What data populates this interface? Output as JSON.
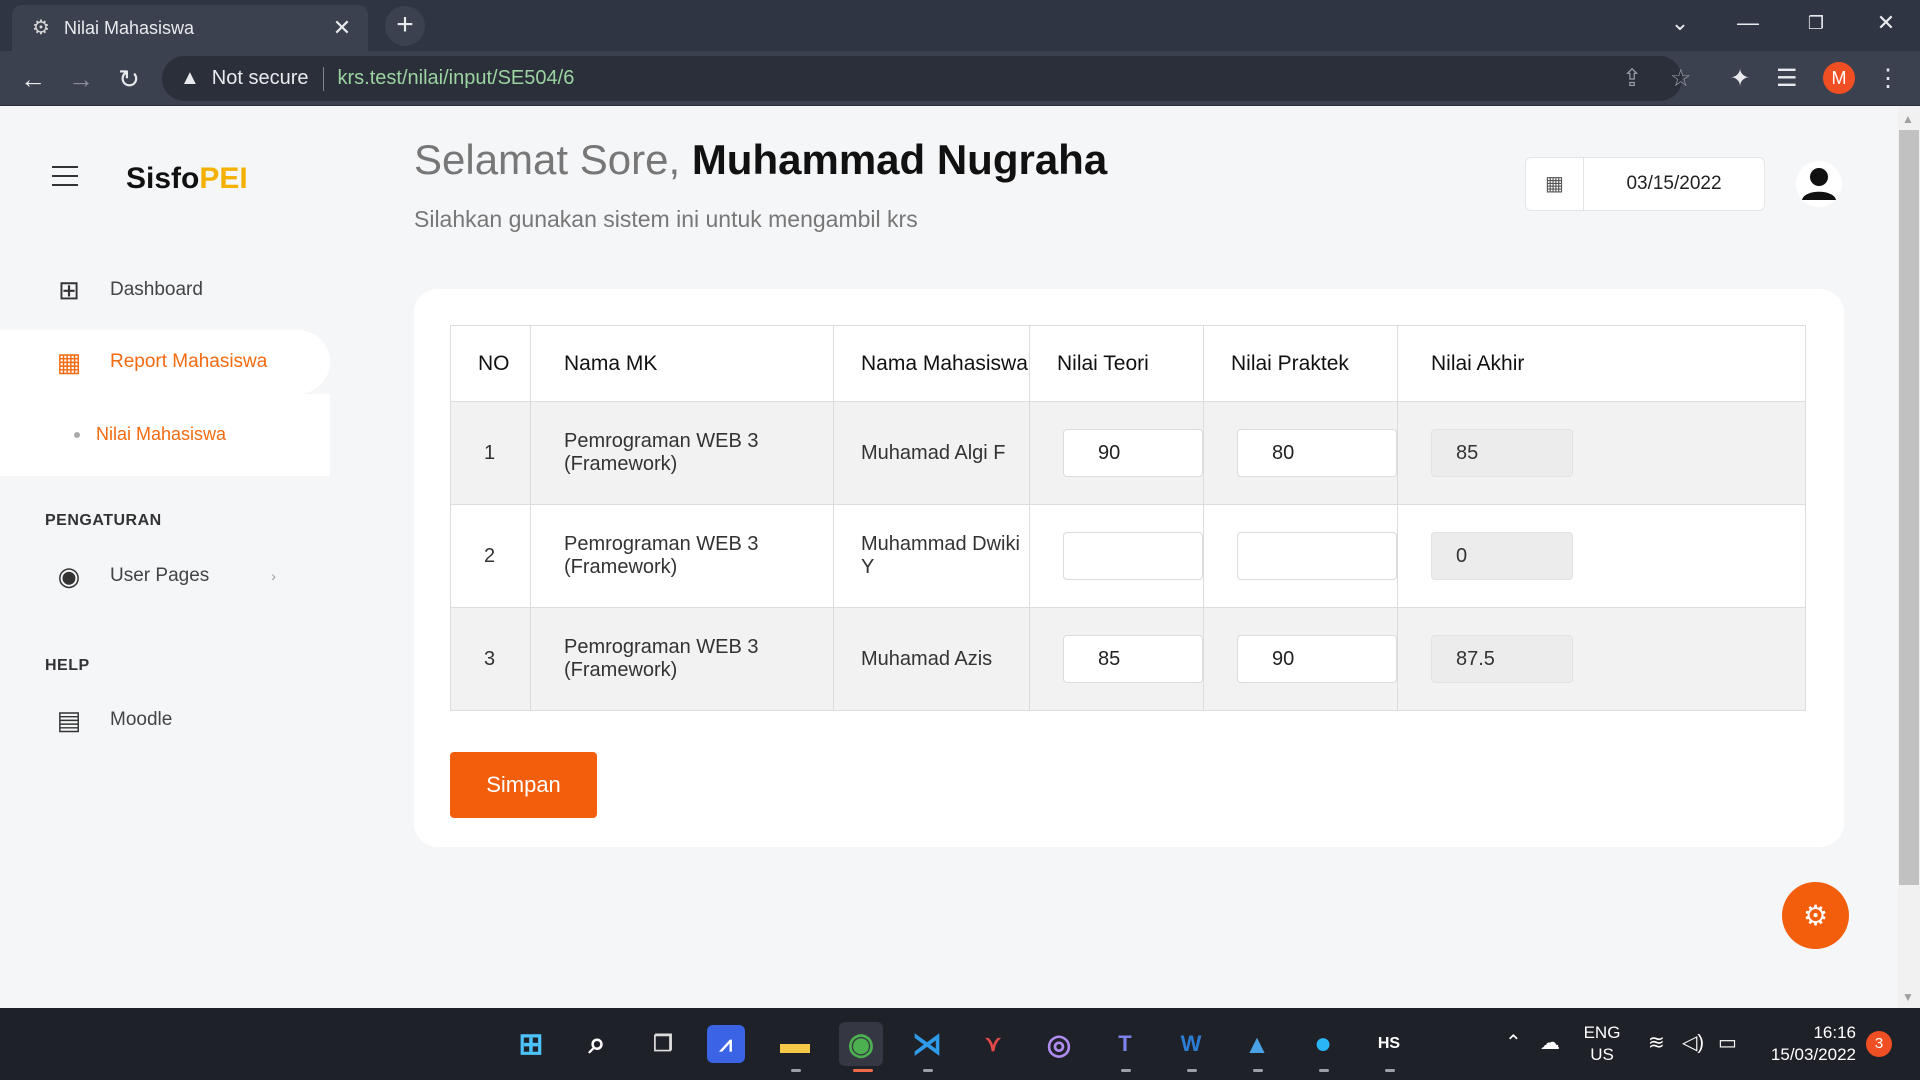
{
  "browser": {
    "tab_title": "Nilai Mahasiswa",
    "tab_close": "✕",
    "new_tab": "+",
    "security_label": "Not secure",
    "url": "krs.test/nilai/input/SE504/6",
    "profile_initial": "M"
  },
  "sidebar": {
    "brand_main": "Sisfo",
    "brand_accent": "PEI",
    "items": [
      {
        "label": "Dashboard",
        "icon": "grid-icon"
      },
      {
        "label": "Report Mahasiswa",
        "icon": "table-icon"
      }
    ],
    "submenu": [
      {
        "label": "Nilai Mahasiswa"
      }
    ],
    "sections": [
      {
        "title": "PENGATURAN",
        "items": [
          {
            "label": "User Pages",
            "icon": "user-circle-icon"
          }
        ]
      },
      {
        "title": "HELP",
        "items": [
          {
            "label": "Moodle",
            "icon": "document-icon"
          }
        ]
      }
    ]
  },
  "header": {
    "greeting": "Selamat Sore,",
    "user_name": "Muhammad Nugraha",
    "subtitle": "Silahkan gunakan sistem ini untuk mengambil krs",
    "date": "03/15/2022"
  },
  "table": {
    "columns": [
      "NO",
      "Nama MK",
      "Nama Mahasiswa",
      "Nilai Teori",
      "Nilai Praktek",
      "Nilai Akhir"
    ],
    "rows": [
      {
        "no": "1",
        "mk": "Pemrograman WEB 3 (Framework)",
        "mahasiswa": "Muhamad Algi F",
        "teori": "90",
        "praktek": "80",
        "akhir": "85"
      },
      {
        "no": "2",
        "mk": "Pemrograman WEB 3 (Framework)",
        "mahasiswa": "Muhammad Dwiki Y",
        "teori": "",
        "praktek": "",
        "akhir": "0"
      },
      {
        "no": "3",
        "mk": "Pemrograman WEB 3 (Framework)",
        "mahasiswa": "Muhamad Azis",
        "teori": "85",
        "praktek": "90",
        "akhir": "87.5"
      }
    ]
  },
  "actions": {
    "save_label": "Simpan"
  },
  "taskbar": {
    "lang_line1": "ENG",
    "lang_line2": "US",
    "time": "16:16",
    "date": "15/03/2022",
    "notification_count": "3"
  },
  "colors": {
    "accent": "#f35e0c",
    "brand_accent": "#f5b100",
    "chrome_bg": "#3c4150"
  }
}
